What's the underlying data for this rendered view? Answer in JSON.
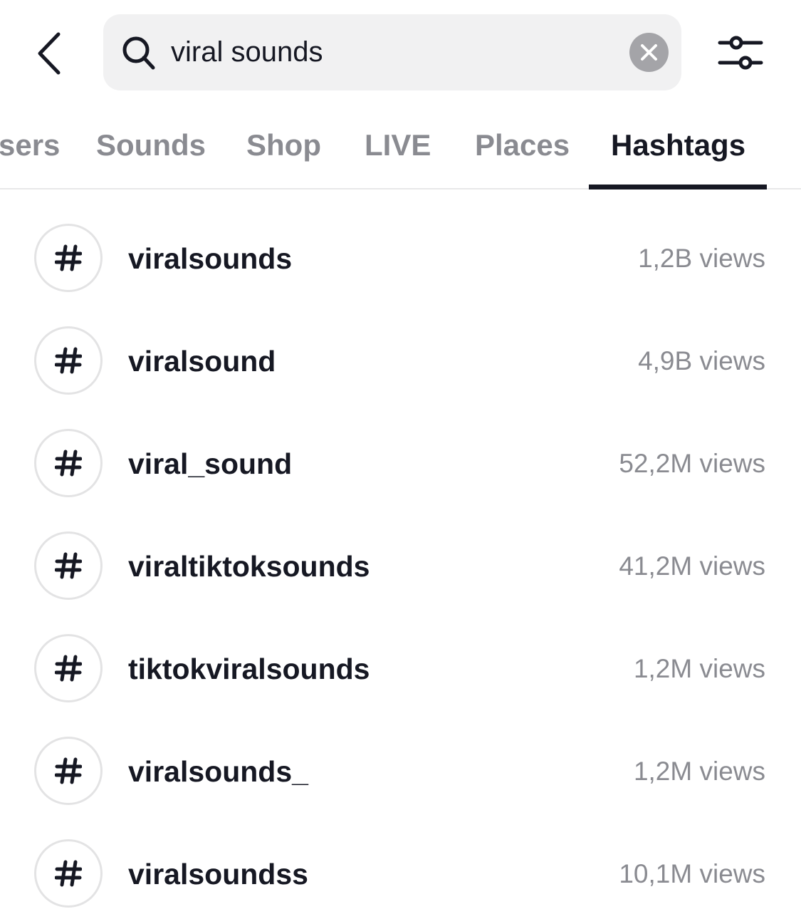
{
  "header": {
    "back_icon": "chevron-left-icon",
    "search": {
      "icon": "search-icon",
      "value": "viral sounds",
      "placeholder": "Search",
      "clear_icon": "close-circle-icon"
    },
    "filter_icon": "sliders-icon"
  },
  "tabs": [
    {
      "label": "Users",
      "visible_text": "sers",
      "active": false
    },
    {
      "label": "Sounds",
      "active": false
    },
    {
      "label": "Shop",
      "active": false
    },
    {
      "label": "LIVE",
      "active": false
    },
    {
      "label": "Places",
      "active": false
    },
    {
      "label": "Hashtags",
      "active": true
    }
  ],
  "hashtags": [
    {
      "icon": "hashtag-icon",
      "name": "viralsounds",
      "views": "1,2B views"
    },
    {
      "icon": "hashtag-icon",
      "name": "viralsound",
      "views": "4,9B views"
    },
    {
      "icon": "hashtag-icon",
      "name": "viral_sound",
      "views": "52,2M views"
    },
    {
      "icon": "hashtag-icon",
      "name": "viraltiktoksounds",
      "views": "41,2M views"
    },
    {
      "icon": "hashtag-icon",
      "name": "tiktokviralsounds",
      "views": "1,2M views"
    },
    {
      "icon": "hashtag-icon",
      "name": "viralsounds_",
      "views": "1,2M views"
    },
    {
      "icon": "hashtag-icon",
      "name": "viralsoundss",
      "views": "10,1M views"
    }
  ],
  "colors": {
    "text_primary": "#161823",
    "text_secondary": "#8a8b91",
    "search_bg": "#f1f1f2",
    "clear_bg": "#a4a4a8",
    "divider": "#e8e8e9"
  }
}
